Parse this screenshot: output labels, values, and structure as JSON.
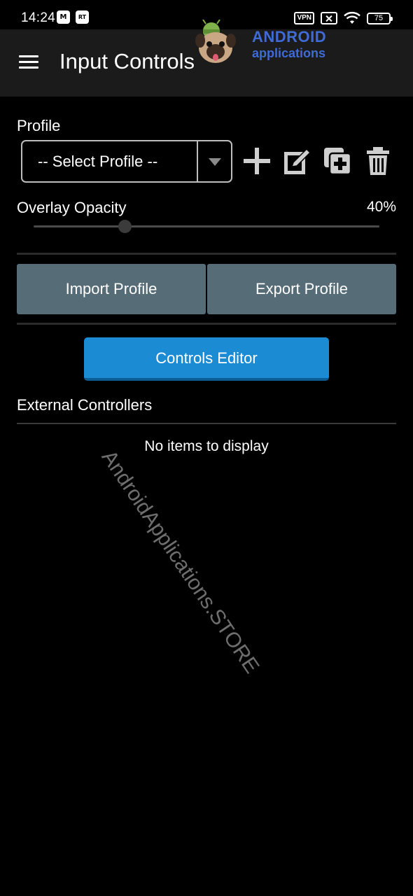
{
  "status_bar": {
    "time": "14:24",
    "notification_icons": [
      "gmail-icon",
      "news-app-icon"
    ],
    "vpn_label": "VPN",
    "battery_level": "75"
  },
  "app_bar": {
    "title": "Input Controls",
    "menu_icon": "hamburger-menu-icon"
  },
  "watermark": {
    "logo_line1": "ANDROID",
    "logo_line2": "applications",
    "diagonal_text": "AndroidApplications.STORE",
    "color": "#3f6bd6"
  },
  "profile": {
    "label": "Profile",
    "select_value": "-- Select Profile --",
    "actions": [
      "add-icon",
      "edit-icon",
      "duplicate-icon",
      "delete-icon"
    ]
  },
  "overlay_opacity": {
    "label": "Overlay Opacity",
    "value_text": "40%",
    "value": 0.4
  },
  "buttons": {
    "import_label": "Import Profile",
    "export_label": "Export Profile",
    "controls_editor_label": "Controls Editor"
  },
  "external_controllers": {
    "label": "External Controllers",
    "empty_message": "No items to display"
  },
  "colors": {
    "background": "#000000",
    "app_bar": "#1b1b1b",
    "secondary_button": "#566c76",
    "primary_button": "#1b8bd4"
  }
}
